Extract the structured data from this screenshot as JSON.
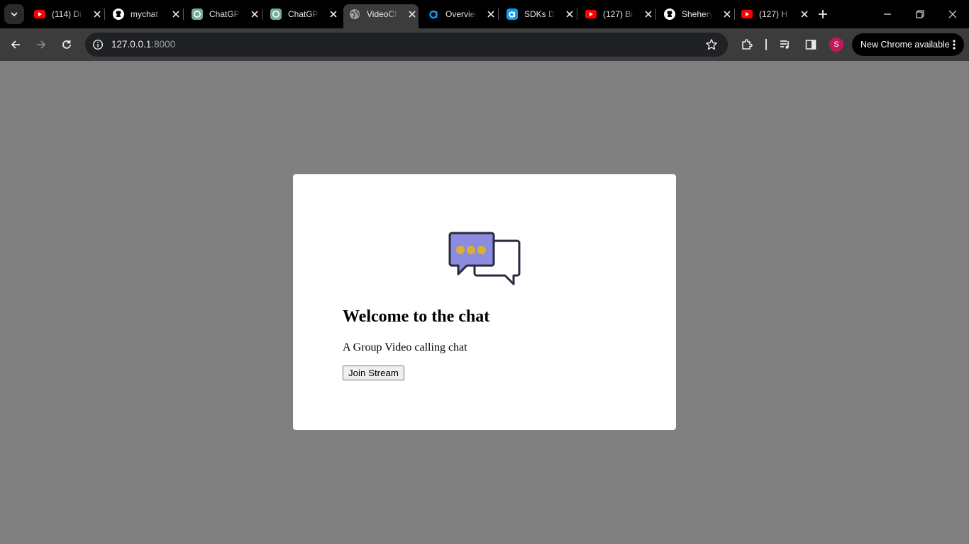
{
  "browser": {
    "tabs": [
      {
        "title": "(114) Di",
        "icon": "youtube-icon"
      },
      {
        "title": "mychat",
        "icon": "github-icon"
      },
      {
        "title": "ChatGPT",
        "icon": "chatgpt-icon"
      },
      {
        "title": "ChatGPT",
        "icon": "chatgpt-icon"
      },
      {
        "title": "VideoChat",
        "icon": "globe-icon",
        "active": true
      },
      {
        "title": "Overview",
        "icon": "agora-icon"
      },
      {
        "title": "SDKs D",
        "icon": "agora-icon"
      },
      {
        "title": "(127) Bi",
        "icon": "youtube-icon"
      },
      {
        "title": "Sheheryar",
        "icon": "github-icon"
      },
      {
        "title": "(127) H",
        "icon": "youtube-icon"
      }
    ],
    "url": {
      "host": "127.0.0.1",
      "port": ":8000"
    },
    "avatar_letter": "S",
    "update_label": "New Chrome available",
    "colors": {
      "tabstrip": "#000000",
      "toolbar": "#3c3c3c",
      "page_bg": "#808080",
      "avatar": "#c2185b"
    }
  },
  "page": {
    "heading": "Welcome to the chat",
    "subtitle": "A Group Video calling chat",
    "join_label": "Join Stream",
    "icon": "chat-bubbles-icon",
    "colors": {
      "bubble_fill": "#8b8bdf",
      "dots": "#d9b033",
      "outline": "#2a2a3a"
    }
  }
}
